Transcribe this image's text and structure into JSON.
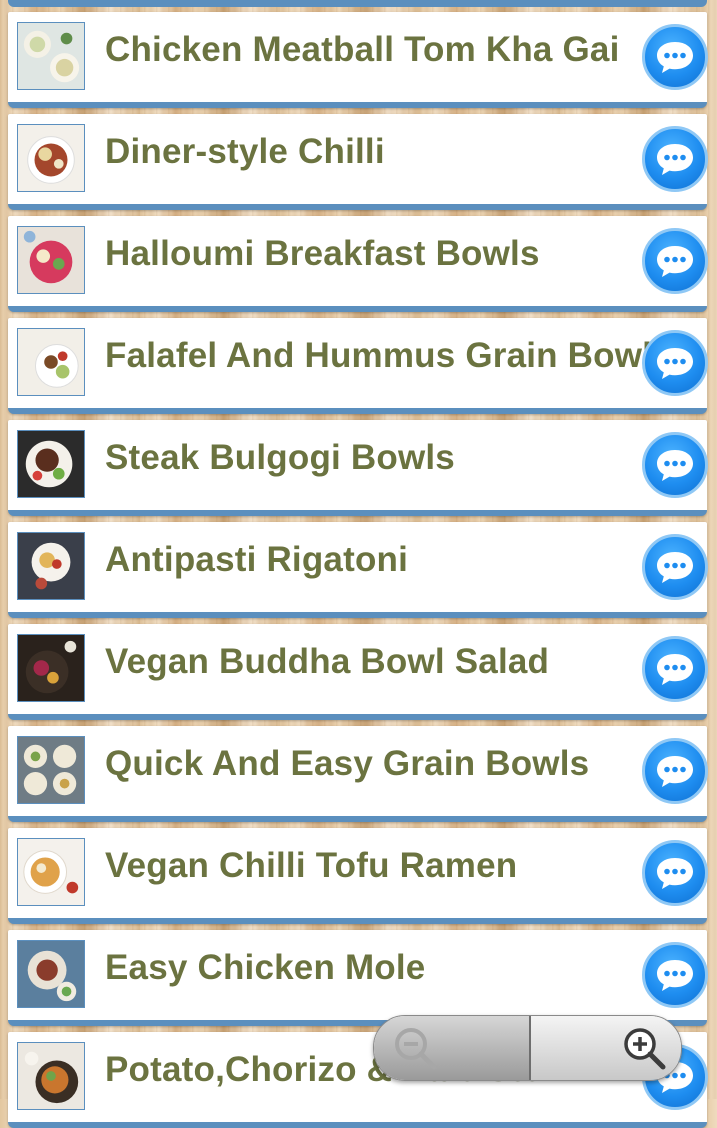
{
  "recipes": [
    {
      "title": "Chicken Meatball Tom Kha Gai"
    },
    {
      "title": "Diner-style Chilli"
    },
    {
      "title": "Halloumi Breakfast Bowls"
    },
    {
      "title": "Falafel And Hummus Grain Bowl"
    },
    {
      "title": "Steak Bulgogi Bowls"
    },
    {
      "title": "Antipasti Rigatoni"
    },
    {
      "title": "Vegan Buddha Bowl Salad"
    },
    {
      "title": "Quick And Easy Grain Bowls"
    },
    {
      "title": "Vegan Chilli Tofu Ramen"
    },
    {
      "title": "Easy Chicken Mole"
    },
    {
      "title": "Potato,Chorizo & Kale Stew"
    }
  ],
  "icons": {
    "comment": "chat-bubble-icon",
    "zoom_out": "zoom-out-icon",
    "zoom_in": "zoom-in-icon"
  },
  "colors": {
    "title_text": "#6b7340",
    "accent_blue": "#5b8fbe",
    "chat_button": "#1e8df0"
  }
}
